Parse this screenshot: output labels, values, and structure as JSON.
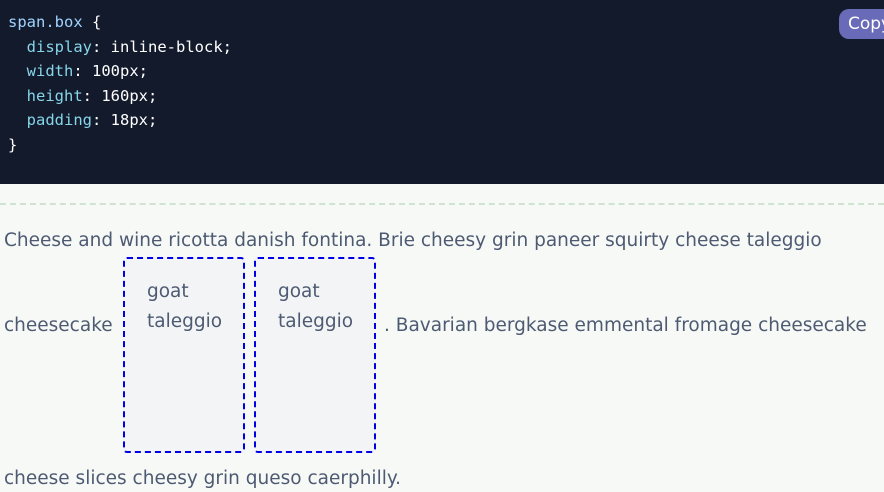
{
  "code": {
    "selector": "span.box",
    "open_brace": " {",
    "close_brace": "}",
    "declarations": [
      {
        "prop": "display",
        "value": "inline-block;"
      },
      {
        "prop": "width",
        "value": "100px;"
      },
      {
        "prop": "height",
        "value": "160px;"
      },
      {
        "prop": "padding",
        "value": "18px;"
      }
    ],
    "copy_label": "Copy"
  },
  "prose": {
    "line1": "Cheese and wine ricotta danish fontina. Brie cheesy grin paneer squirty cheese taleggio",
    "line2_before": "cheesecake",
    "line2_after": ". Bavarian bergkase emmental fromage cheesecake",
    "line3": "cheese slices cheesy grin queso caerphilly."
  },
  "boxes": [
    {
      "word1": "goat",
      "word2": "taleggio"
    },
    {
      "word1": "goat",
      "word2": "taleggio"
    }
  ],
  "colors": {
    "code_bg": "#131a2c",
    "page_bg": "#f7f9f6",
    "text": "#4d5a72",
    "box_border": "#0000e6",
    "copy_button": "#6a6bb8"
  }
}
